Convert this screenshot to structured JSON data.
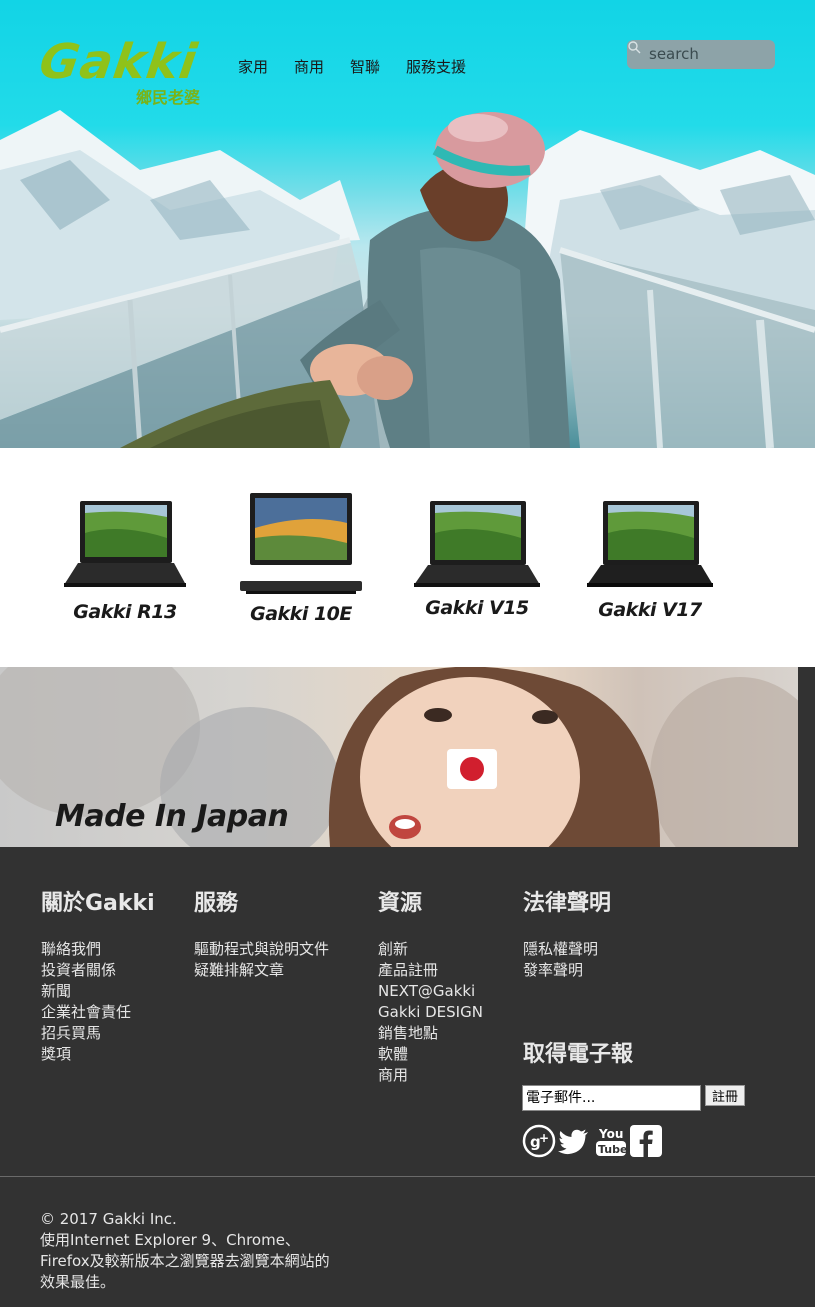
{
  "header": {
    "logo_text": "Gakki",
    "logo_subtitle": "鄉民老婆",
    "nav": [
      "家用",
      "商用",
      "智聯",
      "服務支援"
    ],
    "search_placeholder": "search"
  },
  "products": [
    {
      "name": "Gakki R13"
    },
    {
      "name": "Gakki 10E"
    },
    {
      "name": "Gakki V15"
    },
    {
      "name": "Gakki V17"
    }
  ],
  "banner": {
    "caption": "Made In Japan"
  },
  "footer": {
    "columns": [
      {
        "title": "關於Gakki",
        "links": [
          "聯絡我們",
          "投資者關係",
          "新聞",
          "企業社會責任",
          "招兵買馬",
          "獎項"
        ]
      },
      {
        "title": "服務",
        "links": [
          "驅動程式與說明文件",
          "疑難排解文章"
        ]
      },
      {
        "title": "資源",
        "links": [
          "創新",
          "產品註冊",
          "NEXT@Gakki",
          "Gakki DESIGN",
          "銷售地點",
          "軟體",
          "商用"
        ]
      },
      {
        "title": "法律聲明",
        "links": [
          "隱私權聲明",
          "發率聲明"
        ]
      }
    ],
    "newsletter": {
      "title": "取得電子報",
      "email_placeholder": "電子郵件...",
      "register_label": "註冊"
    },
    "social": [
      "google-plus-icon",
      "twitter-icon",
      "youtube-icon",
      "facebook-icon"
    ],
    "copyright": "© 2017 Gakki Inc.",
    "browser_note": "使用Internet Explorer 9、Chrome、Firefox及較新版本之瀏覽器去瀏覽本網站的效果最佳。"
  },
  "colors": {
    "brand_green": "#8fc21a",
    "footer_bg": "#323232",
    "hero_sky": "#22dbe9"
  }
}
